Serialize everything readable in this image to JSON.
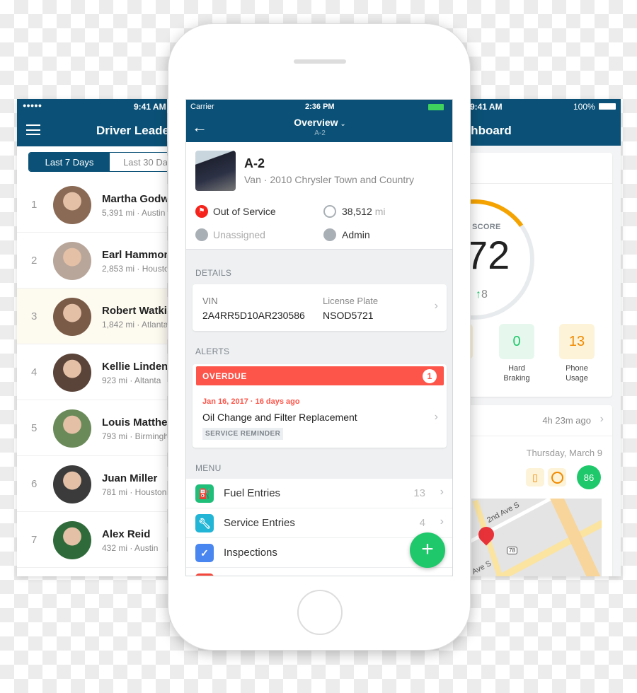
{
  "left_screen": {
    "status": {
      "signal": "●●●●●",
      "time": "9:41 AM"
    },
    "title": "Driver Leaderboard",
    "tabs": [
      "Last 7 Days",
      "Last 30 Days"
    ],
    "active_tab": 0,
    "drivers": [
      {
        "rank": "1",
        "name": "Martha Godwin",
        "sub": "5,391 mi · Austin"
      },
      {
        "rank": "2",
        "name": "Earl Hammond",
        "sub": "2,853 mi · Houston"
      },
      {
        "rank": "3",
        "name": "Robert Watkins",
        "sub": "1,842 mi · Atlanta"
      },
      {
        "rank": "4",
        "name": "Kellie Lindenberg",
        "sub": "923 mi · Altanta"
      },
      {
        "rank": "5",
        "name": "Louis Matthews",
        "sub": "793 mi · Birmingham"
      },
      {
        "rank": "6",
        "name": "Juan Miller",
        "sub": "781 mi · Houston"
      },
      {
        "rank": "7",
        "name": "Alex Reid",
        "sub": "432 mi · Austin"
      }
    ]
  },
  "right_screen": {
    "status": {
      "time": "9:41 AM",
      "battery": "100%"
    },
    "title": "Dashboard",
    "score_label": "SCORE",
    "score": "72",
    "score_fraction": 0.72,
    "score_change": "8",
    "tiles": [
      {
        "value": "0",
        "label1": "Hard",
        "label2": "Braking"
      },
      {
        "value": "13",
        "label1": "Phone",
        "label2": "Usage"
      }
    ],
    "trip": {
      "ago": "4h 23m ago",
      "date": "Thursday, March 9",
      "score": "86"
    },
    "map": {
      "street1": "2nd Ave S",
      "street2": "Ave S",
      "route": "78"
    }
  },
  "phone": {
    "status": {
      "carrier": "Carrier",
      "time": "2:36 PM"
    },
    "nav": {
      "title": "Overview",
      "subtitle": "A-2"
    },
    "vehicle": {
      "name": "A-2",
      "desc": "Van · 2010 Chrysler Town and Country",
      "status": "Out of Service",
      "odometer": "38,512",
      "odometer_unit": "mi",
      "operator": "Unassigned",
      "group": "Admin"
    },
    "details_label": "DETAILS",
    "vin_label": "VIN",
    "vin": "2A4RR5D10AR230586",
    "plate_label": "License Plate",
    "plate": "NSOD5721",
    "alerts_label": "ALERTS",
    "overdue_label": "OVERDUE",
    "overdue_count": "1",
    "alert_date": "Jan 16, 2017 · 16 days ago",
    "alert_title": "Oil Change and Filter Replacement",
    "alert_tag": "SERVICE REMINDER",
    "menu_label": "MENU",
    "menu": [
      {
        "label": "Fuel Entries",
        "count": "13"
      },
      {
        "label": "Service Entries",
        "count": "4"
      },
      {
        "label": "Inspections",
        "count": ""
      }
    ],
    "colors": {
      "navy": "#0b5177",
      "red": "#fd5549",
      "green": "#1fc86b",
      "orange": "#f5a300"
    }
  }
}
